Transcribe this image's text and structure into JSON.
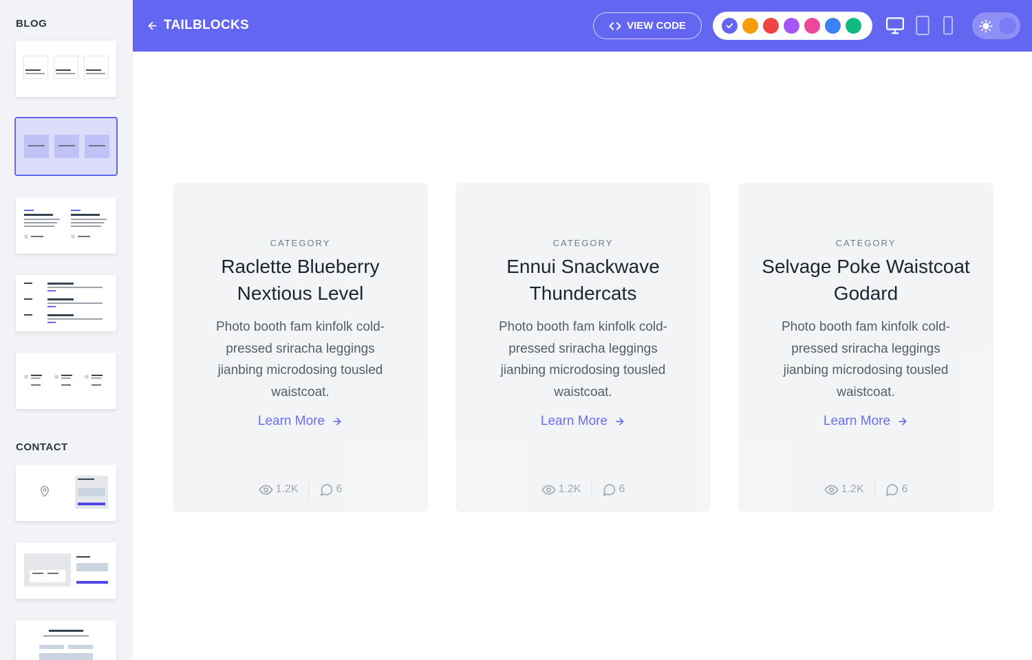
{
  "sidebar": {
    "sections": [
      {
        "heading": "BLOG"
      },
      {
        "heading": "CONTACT"
      }
    ]
  },
  "header": {
    "back_label": "TAILBLOCKS",
    "view_code_label": "VIEW CODE",
    "colors": [
      {
        "name": "indigo",
        "hex": "#6366f1",
        "selected": true
      },
      {
        "name": "yellow",
        "hex": "#f59e0b",
        "selected": false
      },
      {
        "name": "red",
        "hex": "#ef4444",
        "selected": false
      },
      {
        "name": "purple",
        "hex": "#a855f7",
        "selected": false
      },
      {
        "name": "pink",
        "hex": "#ec4899",
        "selected": false
      },
      {
        "name": "blue",
        "hex": "#3b82f6",
        "selected": false
      },
      {
        "name": "green",
        "hex": "#10b981",
        "selected": false
      }
    ],
    "devices": [
      "desktop-icon",
      "tablet-icon",
      "phone-icon"
    ],
    "theme_icon": "sun-icon"
  },
  "cards": [
    {
      "category": "CATEGORY",
      "title": "Raclette Blueberry Nextious Level",
      "description": "Photo booth fam kinfolk cold-pressed sriracha leggings jianbing microdosing tousled waistcoat.",
      "link_label": "Learn More",
      "views": "1.2K",
      "comments": "6"
    },
    {
      "category": "CATEGORY",
      "title": "Ennui Snackwave Thundercats",
      "description": "Photo booth fam kinfolk cold-pressed sriracha leggings jianbing microdosing tousled waistcoat.",
      "link_label": "Learn More",
      "views": "1.2K",
      "comments": "6"
    },
    {
      "category": "CATEGORY",
      "title": "Selvage Poke Waistcoat Godard",
      "description": "Photo booth fam kinfolk cold-pressed sriracha leggings jianbing microdosing tousled waistcoat.",
      "link_label": "Learn More",
      "views": "1.2K",
      "comments": "6"
    }
  ],
  "colors": {
    "accent": "#6366f1",
    "card_bg": "#f3f4f6",
    "sidebar_bg": "#f1f3f6"
  }
}
